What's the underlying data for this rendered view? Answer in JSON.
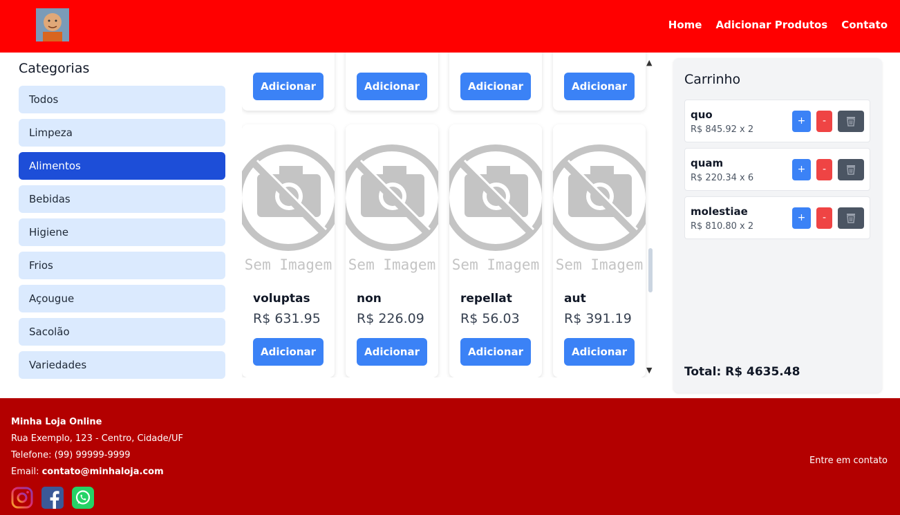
{
  "header": {
    "nav": [
      "Home",
      "Adicionar Produtos",
      "Contato"
    ]
  },
  "categories": {
    "title": "Categorias",
    "items": [
      "Todos",
      "Limpeza",
      "Alimentos",
      "Bebidas",
      "Higiene",
      "Frios",
      "Açougue",
      "Sacolão",
      "Variedades"
    ],
    "active": "Alimentos"
  },
  "products": {
    "add_label": "Adicionar",
    "no_image_text": "Sem Imagem",
    "bottom_row": [
      {
        "name": "voluptas",
        "price": "R$ 631.95"
      },
      {
        "name": "non",
        "price": "R$ 226.09"
      },
      {
        "name": "repellat",
        "price": "R$ 56.03"
      },
      {
        "name": "aut",
        "price": "R$ 391.19"
      }
    ]
  },
  "cart": {
    "title": "Carrinho",
    "items": [
      {
        "name": "quo",
        "price": "R$ 845.92 x 2"
      },
      {
        "name": "quam",
        "price": "R$ 220.34 x 6"
      },
      {
        "name": "molestiae",
        "price": "R$ 810.80 x 2"
      }
    ],
    "plus": "+",
    "minus": "-",
    "total": "Total: R$ 4635.48"
  },
  "footer": {
    "store_name": "Minha Loja Online",
    "address": "Rua Exemplo, 123 - Centro, Cidade/UF",
    "phone": "Telefone: (99) 99999-9999",
    "email_label": "Email: ",
    "email": "contato@minhaloja.com",
    "contact_link": "Entre em contato",
    "social": [
      "instagram-icon",
      "facebook-icon",
      "whatsapp-icon"
    ]
  },
  "colors": {
    "header": "#ff0000",
    "footer": "#b30000",
    "primary": "#3b82f6",
    "active_category": "#1d4ed8",
    "category_bg": "#dbeafe"
  }
}
